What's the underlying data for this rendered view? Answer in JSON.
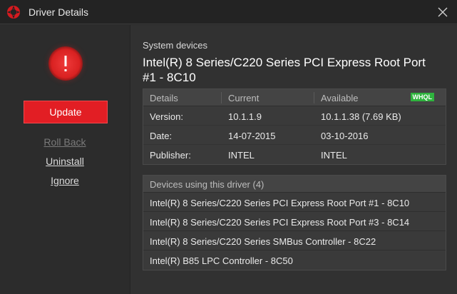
{
  "window": {
    "title": "Driver Details",
    "logo_icon": "app-logo-icon",
    "close_icon": "close-icon"
  },
  "sidebar": {
    "alert_icon": "exclamation-alert-icon",
    "update_label": "Update",
    "rollback_label": "Roll Back",
    "rollback_enabled": false,
    "uninstall_label": "Uninstall",
    "ignore_label": "Ignore"
  },
  "main": {
    "section_label": "System devices",
    "device_name": "Intel(R) 8 Series/C220 Series PCI Express Root Port #1 - 8C10",
    "details": {
      "headers": [
        "Details",
        "Current",
        "Available"
      ],
      "whql_badge": "WHQL",
      "rows": [
        {
          "label": "Version:",
          "current": "10.1.1.9",
          "available": "10.1.1.38 (7.69 KB)"
        },
        {
          "label": "Date:",
          "current": "14-07-2015",
          "available": "03-10-2016"
        },
        {
          "label": "Publisher:",
          "current": "INTEL",
          "available": "INTEL"
        }
      ]
    },
    "devices": {
      "header": "Devices using this driver (4)",
      "items": [
        "Intel(R) 8 Series/C220 Series PCI Express Root Port #1 - 8C10",
        "Intel(R) 8 Series/C220 Series PCI Express Root Port #3 - 8C14",
        "Intel(R) 8 Series/C220 Series SMBus Controller - 8C22",
        "Intel(R) B85 LPC Controller - 8C50"
      ]
    }
  },
  "colors": {
    "accent": "#e21e24",
    "whql": "#2fb43e",
    "background": "#2b2b2b"
  }
}
